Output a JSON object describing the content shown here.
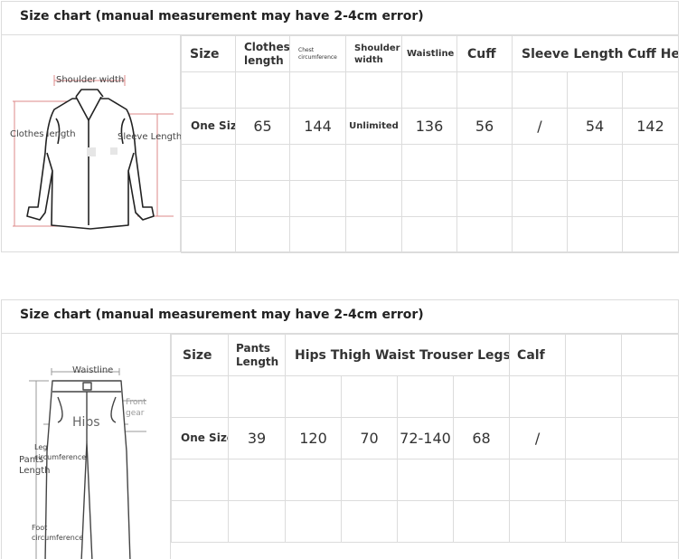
{
  "top": {
    "title": "Size chart (manual measurement may have 2-4cm error)",
    "illustration": {
      "label_shoulder": "Shoulder width",
      "label_clothes": "Clothes length",
      "label_sleeve": "Sleeve Length"
    },
    "headers": [
      "Size",
      "Clothes length",
      "Chest circumference",
      "Shoulder width",
      "Waistline",
      "Cuff",
      "Sleeve Length",
      "Cuff Hem"
    ],
    "row_label": "One Size",
    "values": [
      "65",
      "144",
      "Unlimited",
      "136",
      "56",
      "/",
      "54",
      "142"
    ]
  },
  "bottom": {
    "title": "Size chart (manual measurement may have 2-4cm error)",
    "illustration": {
      "label_waistline": "Waistline",
      "label_front_gear": "Front gear",
      "label_hips": "Hips",
      "label_leg": "Leg circumference",
      "label_pants": "Pants Length",
      "label_foot": "Foot circumference"
    },
    "headers": [
      "Size",
      "Pants Length",
      "Hips",
      "Thigh",
      "Waist",
      "Trouser Legs",
      "Calf",
      "",
      ""
    ],
    "row_label": "One Size",
    "values": [
      "39",
      "120",
      "70",
      "72-140",
      "68",
      "/",
      "",
      ""
    ]
  }
}
